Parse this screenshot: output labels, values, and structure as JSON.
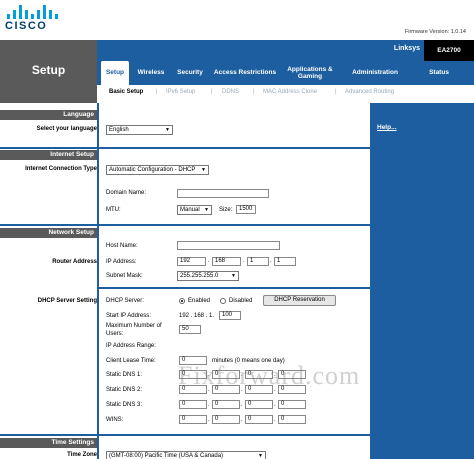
{
  "brand": {
    "logo_text": "CISCO",
    "firmware": "Firmware Version: 1.0.14"
  },
  "header": {
    "page_title": "Setup",
    "brand_label": "Linksys",
    "model": "EA2700",
    "tabs": [
      "Setup",
      "Wireless",
      "Security",
      "Access Restrictions",
      "Applications & Gaming",
      "Administration",
      "Status"
    ],
    "subtabs": [
      "Basic Setup",
      "IPv6 Setup",
      "DDNS",
      "MAC Address Clone",
      "Advanced Routing"
    ]
  },
  "help_link": "Help...",
  "sections": {
    "language": {
      "head": "Language",
      "label": "Select your language",
      "value": "English"
    },
    "internet": {
      "head": "Internet Setup",
      "label": "Internet Connection Type",
      "type_value": "Automatic Configuration - DHCP",
      "domain_label": "Domain Name:",
      "domain_value": "",
      "mtu_label": "MTU:",
      "mtu_mode": "Manual",
      "size_label": "Size:",
      "size_value": "1500"
    },
    "network": {
      "head": "Network Setup",
      "router_label": "Router Address",
      "host_label": "Host Name:",
      "host_value": "",
      "ip_label": "IP Address:",
      "ip": [
        "192",
        "168",
        "1",
        "1"
      ],
      "mask_label": "Subnet Mask:",
      "mask_value": "255.255.255.0"
    },
    "dhcp": {
      "label": "DHCP Server Setting",
      "server_label": "DHCP Server:",
      "enabled_label": "Enabled",
      "disabled_label": "Disabled",
      "reservation_button": "DHCP Reservation",
      "start_label": "Start IP  Address:",
      "start_prefix": "192 . 168 . 1.",
      "start_value": "100",
      "max_label_1": "Maximum Number of",
      "max_label_2": "Users:",
      "max_value": "50",
      "range_label": "IP Address Range:",
      "lease_label": "Client Lease Time:",
      "lease_value": "0",
      "lease_note": "minutes (0 means one day)",
      "dns1_label": "Static DNS 1:",
      "dns2_label": "Static DNS 2:",
      "dns3_label": "Static DNS 3:",
      "wins_label": "WINS:",
      "octet_default": "0"
    },
    "time": {
      "head": "Time Settings",
      "label": "Time Zone",
      "value": "(GMT-08:00) Pacific Time (USA & Canada)"
    }
  },
  "watermark": "Fixforward.com",
  "colors": {
    "nav_blue": "#1c5ea0",
    "gray": "#5a5a5a",
    "cisco_blue": "#049fd9"
  }
}
